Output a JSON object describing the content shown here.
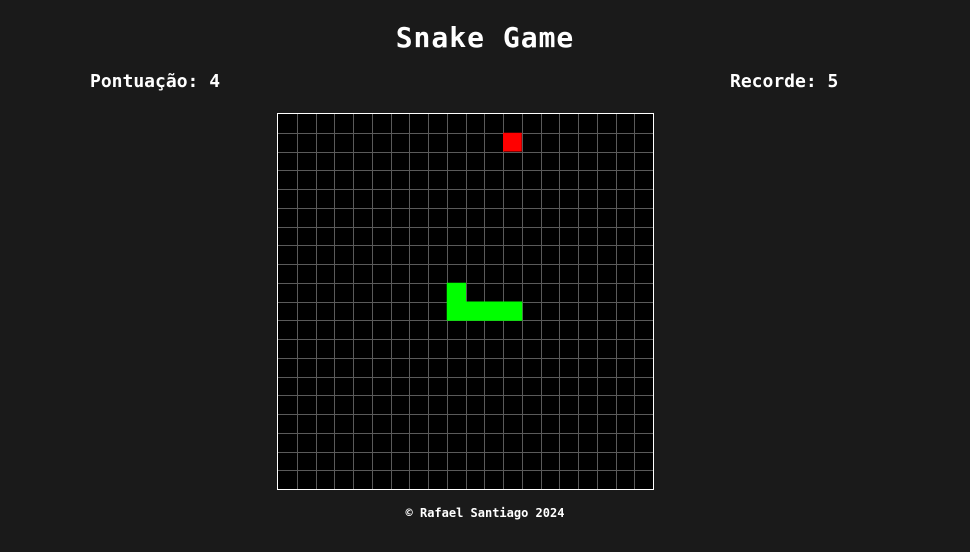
{
  "title": "Snake Game",
  "score_text": "Pontuação: 4",
  "record_text": "Recorde: 5",
  "footer": "© Rafael Santiago 2024",
  "board": {
    "cols": 20,
    "rows": 20,
    "background_color": "#000000",
    "grid_color": "#5a5a5a",
    "snake_color": "#00ff00",
    "food_color": "#ff0000",
    "snake": [
      [
        9,
        10
      ],
      [
        10,
        10
      ],
      [
        11,
        10
      ],
      [
        12,
        10
      ],
      [
        9,
        9
      ]
    ],
    "food": [
      12,
      1
    ]
  }
}
